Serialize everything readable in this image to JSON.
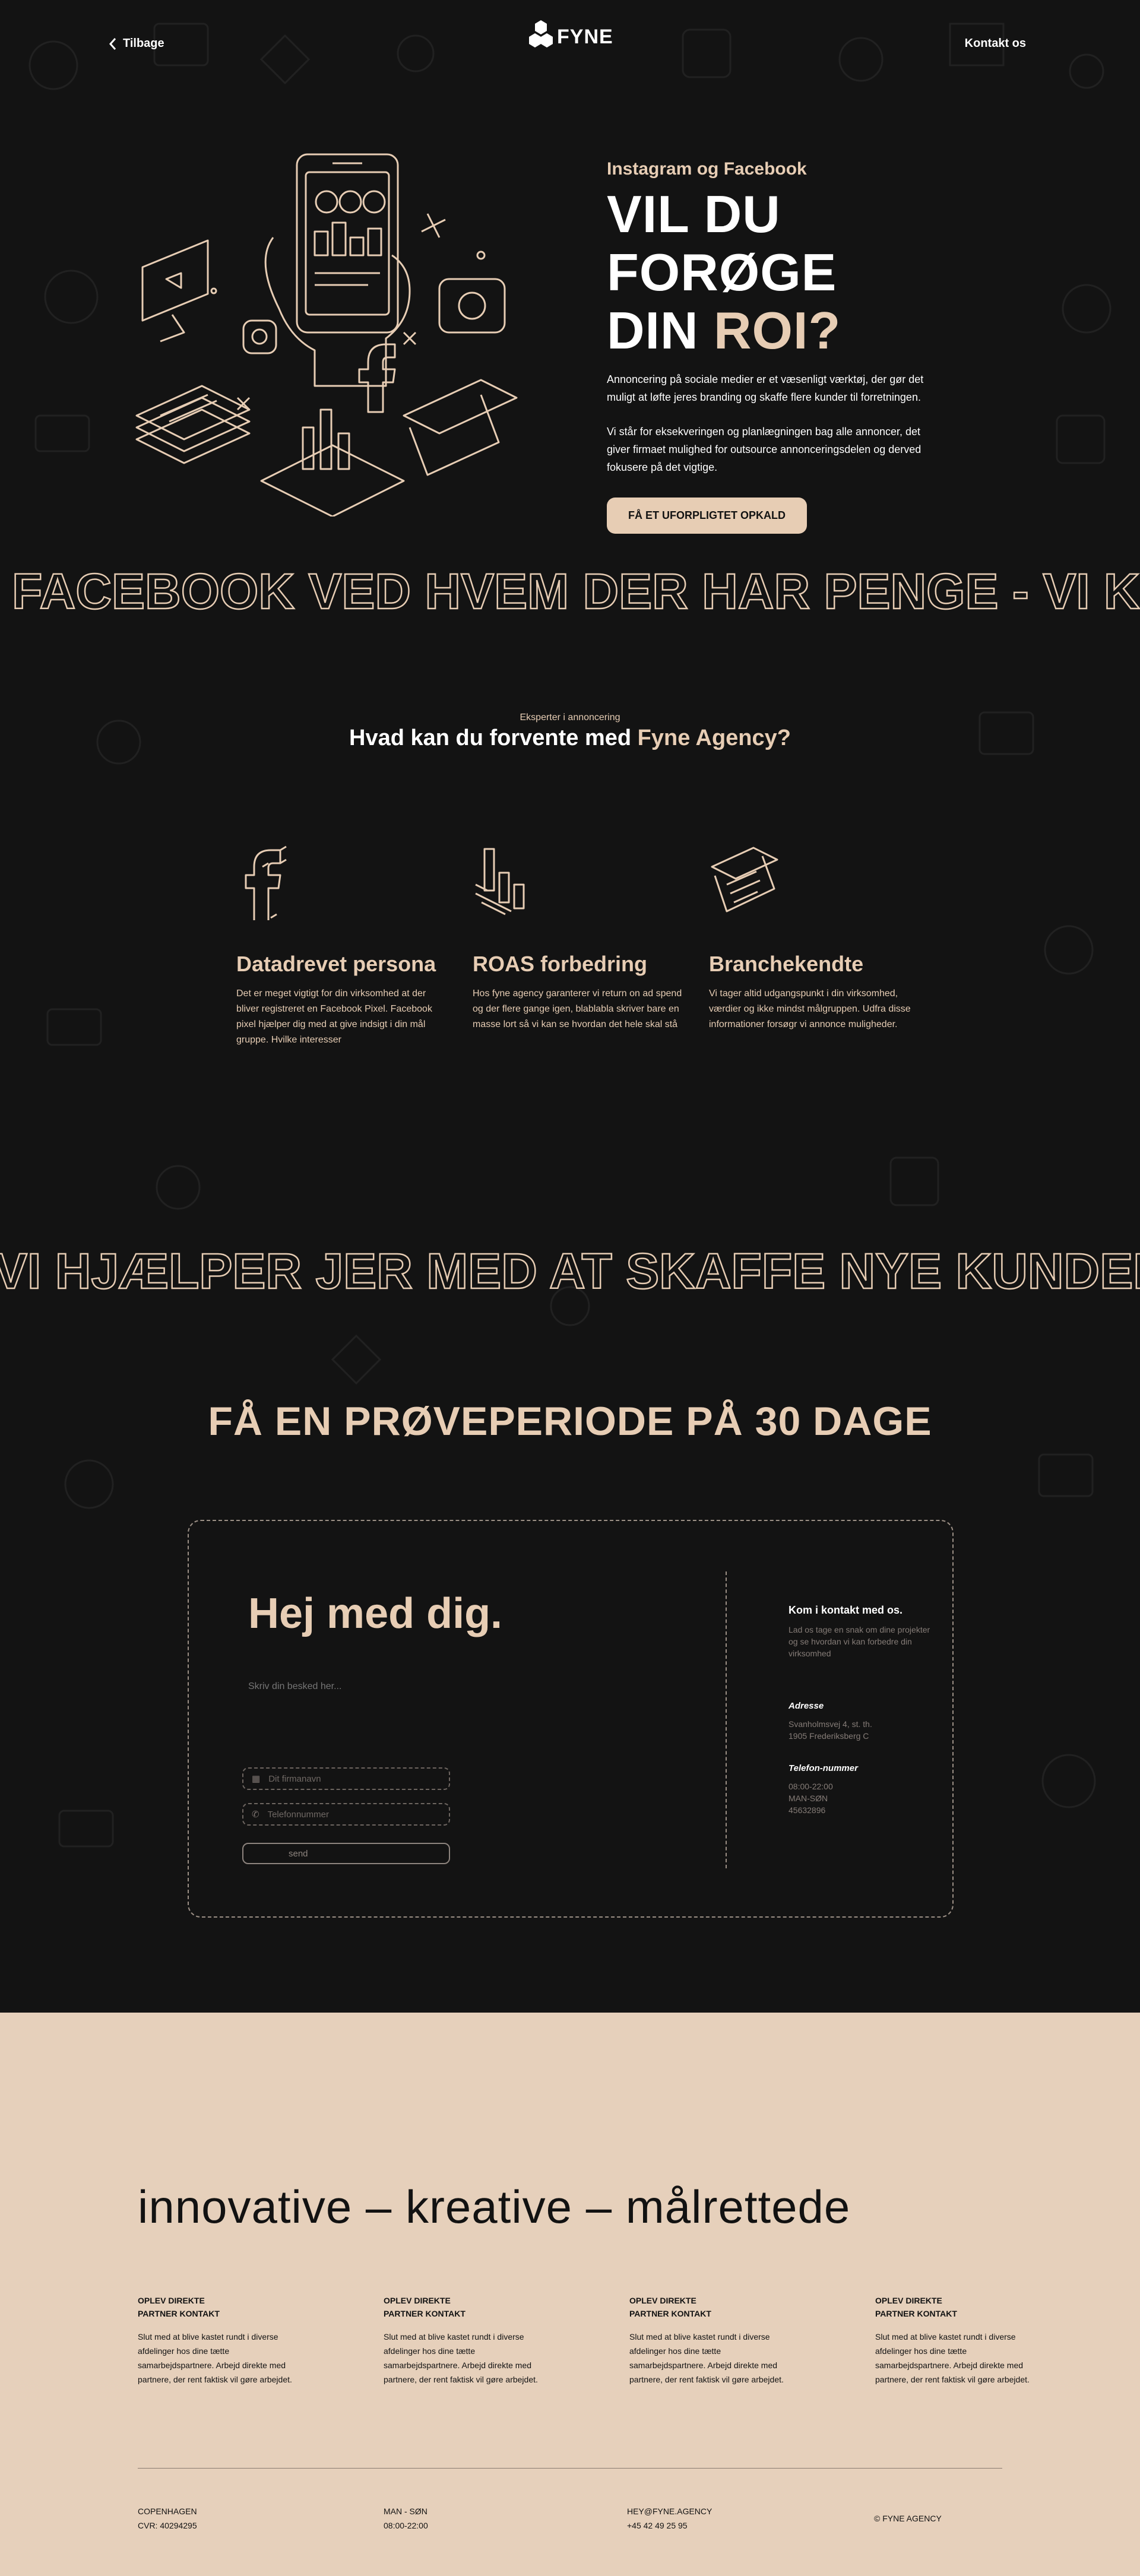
{
  "header": {
    "back_label": "Tilbage",
    "logo_text": "FYNE",
    "contact_label": "Kontakt os"
  },
  "hero": {
    "kicker": "Instagram og Facebook",
    "title_line1": "VIL DU FORØGE",
    "title_line2_prefix": "DIN ",
    "title_line2_accent": "ROI?",
    "paragraph1": "Annoncering på sociale medier er et væsenligt værktøj, der gør det muligt at løfte jeres branding og skaffe flere kunder til forretningen.",
    "paragraph2": "Vi står for eksekveringen og planlægningen bag alle annoncer, det giver firmaet mulighed for outsource annonceringsdelen og derved fokusere på det vigtige.",
    "cta_label": "FÅ ET UFORPLIGTET OPKALD"
  },
  "marquee1": "FACEBOOK VED HVEM DER HAR PENGE - VI KENDER FACEBOOK",
  "features": {
    "kicker": "Eksperter i annoncering",
    "title_prefix": "Hvad kan du forvente med ",
    "title_accent": "Fyne Agency?",
    "items": [
      {
        "icon": "facebook-icon",
        "title": "Datadrevet persona",
        "text": "Det er meget vigtigt for din virksomhed at der bliver registreret en Facebook Pixel. Facebook pixel hjælper dig med at give indsigt i din mål gruppe. Hvilke interesser"
      },
      {
        "icon": "bar-chart-icon",
        "title": "ROAS forbedring",
        "text": "Hos fyne agency garanterer vi return on ad spend og der flere gange igen, blablabla skriver bare en masse lort så vi kan se hvordan det hele skal stå"
      },
      {
        "icon": "newspaper-icon",
        "title": "Branchekendte",
        "text": "Vi tager altid udgangspunkt i din virksomhed, værdier og ikke mindst målgruppen. Udfra disse informationer forsøgr vi annonce muligheder."
      }
    ]
  },
  "marquee2": "VI HJÆLPER JER MED AT SKAFFE NYE KUNDER SAMMEN",
  "trial": {
    "title": "FÅ EN PRØVEPERIODE PÅ 30 DAGE",
    "greeting": "Hej med dig.",
    "message_placeholder": "Skriv din besked her...",
    "company_placeholder": "Dit firmanavn",
    "phone_placeholder": "Telefonnummer",
    "send_label": "send",
    "side_title": "Kom i kontakt med os.",
    "side_text": "Lad os tage en snak om dine projekter og se hvordan vi kan forbedre din virksomhed",
    "address_label": "Adresse",
    "address_line1": "Svanholmsvej 4, st. th.",
    "address_line2": "1905 Frederiksberg C",
    "phone_label": "Telefon-nummer",
    "phone_hours": "08:00-22:00",
    "phone_days": "MAN-SØN",
    "phone_number": "45632896"
  },
  "footer": {
    "tagline": "innovative – kreative – målrettede",
    "columns": [
      {
        "title_line1": "OPLEV DIREKTE",
        "title_line2": "PARTNER KONTAKT",
        "text": "Slut med at blive kastet rundt i diverse afdelinger hos dine tætte samarbejdspartnere. Arbejd direkte med partnere, der rent faktisk vil gøre arbejdet."
      },
      {
        "title_line1": "OPLEV DIREKTE",
        "title_line2": "PARTNER KONTAKT",
        "text": "Slut med at blive kastet rundt i diverse afdelinger hos dine tætte samarbejdspartnere. Arbejd direkte med partnere, der rent faktisk vil gøre arbejdet."
      },
      {
        "title_line1": "OPLEV DIREKTE",
        "title_line2": "PARTNER KONTAKT",
        "text": "Slut med at blive kastet rundt i diverse afdelinger hos dine tætte samarbejdspartnere. Arbejd direkte med partnere, der rent faktisk vil gøre arbejdet."
      },
      {
        "title_line1": "OPLEV DIREKTE",
        "title_line2": "PARTNER KONTAKT",
        "text": "Slut med at blive kastet rundt i diverse afdelinger hos dine tætte samarbejdspartnere. Arbejd direkte med partnere, der rent faktisk vil gøre arbejdet."
      }
    ],
    "bottom": {
      "city": "COPENHAGEN",
      "cvr": "CVR: 40294295",
      "days": "MAN - SØN",
      "hours": "08:00-22:00",
      "email": "HEY@FYNE.AGENCY",
      "phone": "+45 42 49 25 95",
      "copyright": "© FYNE AGENCY"
    }
  },
  "colors": {
    "background": "#131313",
    "accent": "#e7cdb4",
    "footer_bg": "#e6d0bb"
  }
}
